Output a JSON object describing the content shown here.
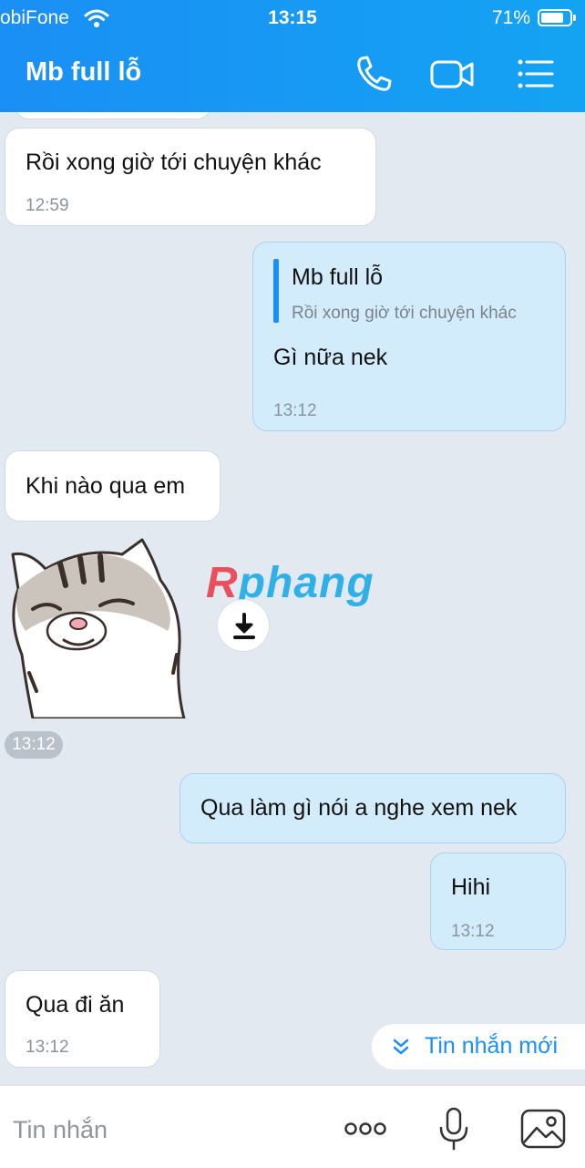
{
  "status_bar": {
    "carrier": "obiFone",
    "time": "13:15",
    "battery": "71%"
  },
  "header": {
    "title": "Mb full lỗ"
  },
  "messages": {
    "m1": {
      "text": "Rồi xong giờ tới chuyện khác",
      "time": "12:59"
    },
    "m2": {
      "quote_name": "Mb full lỗ",
      "quote_text": "Rồi xong giờ tới chuyện khác",
      "text": "Gì nữa nek",
      "time": "13:12"
    },
    "m3": {
      "text": "Khi nào qua em"
    },
    "sticker": {
      "time": "13:12"
    },
    "m4": {
      "text": "Qua làm gì nói a nghe xem nek"
    },
    "m5": {
      "text": "Hihi",
      "time": "13:12"
    },
    "m6": {
      "text": "Qua đi ăn",
      "time": "13:12"
    }
  },
  "watermark": {
    "first": "R",
    "rest": "phang"
  },
  "new_messages_label": "Tin nhắn mới",
  "composer": {
    "placeholder": "Tin nhắn"
  },
  "colors": {
    "header": "#1a8ff5",
    "outgoing_bubble": "#d3ecfb",
    "incoming_bubble": "#ffffff",
    "background": "#e2e9f1"
  },
  "icons": [
    "wifi-icon",
    "phone-icon",
    "video-icon",
    "menu-list-icon",
    "download-icon",
    "chevrons-down-icon",
    "more-icon",
    "microphone-icon",
    "image-icon"
  ]
}
